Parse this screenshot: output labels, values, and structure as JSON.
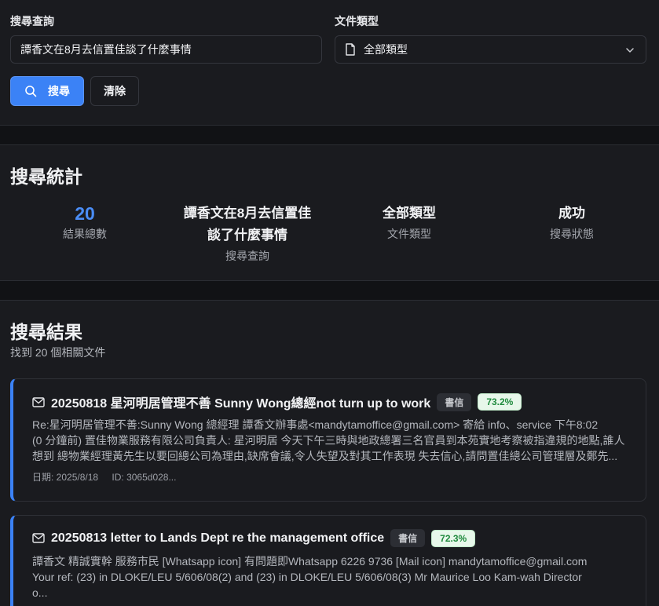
{
  "search": {
    "query_label": "搜尋查詢",
    "query_value": "譚香文在8月去信置佳談了什麼事情",
    "type_label": "文件類型",
    "type_value": "全部類型",
    "search_button": "搜尋",
    "clear_button": "清除"
  },
  "stats": {
    "title": "搜尋統計",
    "items": [
      {
        "value": "20",
        "label": "結果總數"
      },
      {
        "value_line1": "譚香文在8月去信置佳",
        "value_line2": "談了什麼事情",
        "label": "搜尋查詢"
      },
      {
        "value": "全部類型",
        "label": "文件類型"
      },
      {
        "value": "成功",
        "label": "搜尋狀態"
      }
    ]
  },
  "results": {
    "title": "搜尋結果",
    "subtitle": "找到 20 個相關文件",
    "cards": [
      {
        "title": "20250818 星河明居管理不善 Sunny Wong總經not turn up to work",
        "type_badge": "書信",
        "score": "73.2%",
        "lines": [
          "Re:星河明居管理不善:Sunny Wong 總經理 譚香文辦事處<mandytamoffice@gmail.com> 寄給 info、service 下午8:02",
          "(0 分鐘前) 置佳物業服務有限公司負責人: 星河明居 今天下午三時與地政總署三名官員到本苑實地考察被指違規的地點,誰人",
          "想到 總物業經理黃先生以要回總公司為理由,缺席會議,令人失望及對其工作表現 失去信心,請問置佳總公司管理層及鄭先..."
        ],
        "date": "日期: 2025/8/18",
        "id": "ID: 3065d028..."
      },
      {
        "title": "20250813 letter to Lands Dept re the management office",
        "type_badge": "書信",
        "score": "72.3%",
        "lines": [
          "譚香文 精誠實幹 服務市民 [Whatsapp icon] 有問題即Whatsapp 6226 9736 [Mail icon] mandytamoffice@gmail.com",
          "Your ref: (23) in DLOKE/LEU 5/606/08(2) and (23) in DLOKE/LEU 5/606/08(3) Mr Maurice Loo Kam-wah Director",
          "o..."
        ]
      }
    ]
  },
  "colors": {
    "accent": "#3b82f6",
    "background": "#111215",
    "panel": "#1a1b1f",
    "score_text": "#1f8a3d"
  }
}
